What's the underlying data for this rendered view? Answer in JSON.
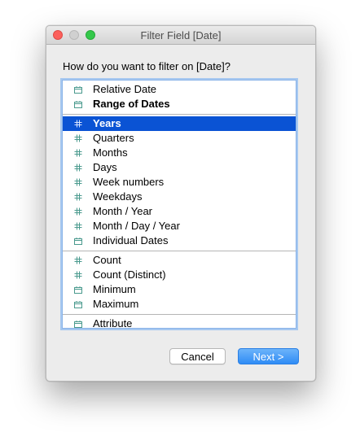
{
  "window": {
    "title": "Filter Field [Date]"
  },
  "prompt": "How do you want to filter on [Date]?",
  "groups": [
    {
      "items": [
        {
          "label": "Relative Date",
          "icon": "calendar-icon",
          "bold": false,
          "selected": false
        },
        {
          "label": "Range of Dates",
          "icon": "calendar-icon",
          "bold": true,
          "selected": false
        }
      ]
    },
    {
      "items": [
        {
          "label": "Years",
          "icon": "hash-icon",
          "bold": true,
          "selected": true
        },
        {
          "label": "Quarters",
          "icon": "hash-icon",
          "bold": false,
          "selected": false
        },
        {
          "label": "Months",
          "icon": "hash-icon",
          "bold": false,
          "selected": false
        },
        {
          "label": "Days",
          "icon": "hash-icon",
          "bold": false,
          "selected": false
        },
        {
          "label": "Week numbers",
          "icon": "hash-icon",
          "bold": false,
          "selected": false
        },
        {
          "label": "Weekdays",
          "icon": "hash-icon",
          "bold": false,
          "selected": false
        },
        {
          "label": "Month / Year",
          "icon": "hash-icon",
          "bold": false,
          "selected": false
        },
        {
          "label": "Month / Day / Year",
          "icon": "hash-icon",
          "bold": false,
          "selected": false
        },
        {
          "label": "Individual Dates",
          "icon": "calendar-icon",
          "bold": false,
          "selected": false
        }
      ]
    },
    {
      "items": [
        {
          "label": "Count",
          "icon": "hash-icon",
          "bold": false,
          "selected": false
        },
        {
          "label": "Count (Distinct)",
          "icon": "hash-icon",
          "bold": false,
          "selected": false
        },
        {
          "label": "Minimum",
          "icon": "calendar-icon",
          "bold": false,
          "selected": false
        },
        {
          "label": "Maximum",
          "icon": "calendar-icon",
          "bold": false,
          "selected": false
        }
      ]
    },
    {
      "items": [
        {
          "label": "Attribute",
          "icon": "calendar-icon",
          "bold": false,
          "selected": false
        }
      ]
    }
  ],
  "buttons": {
    "cancel": "Cancel",
    "next": "Next >"
  },
  "colors": {
    "selection": "#0a53d4",
    "icon": "#4a9a8e",
    "primary_button": "#2f8cf5",
    "close": "#fc605c",
    "maximize": "#34c84a"
  }
}
